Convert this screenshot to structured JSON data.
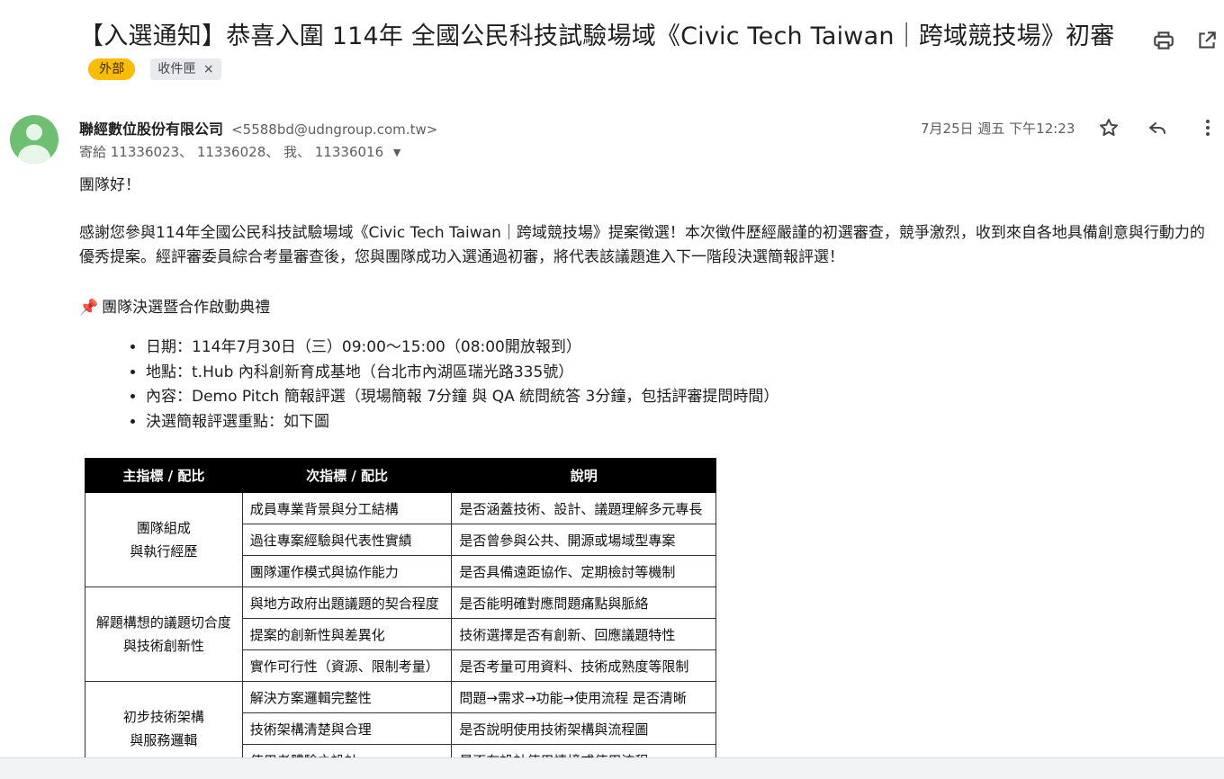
{
  "subject": {
    "title": "【入選通知】恭喜入圍 114年 全國公民科技試驗場域《Civic Tech Taiwan｜跨域競技場》初審",
    "badge_external": "外部",
    "badge_inbox": "收件匣",
    "badge_inbox_close": "×"
  },
  "toolbar": {
    "print_icon": "print-icon",
    "popout_icon": "open-in-new-window-icon"
  },
  "message": {
    "sender_name": "聯經數位股份有限公司",
    "sender_email": "<5588bd@udngroup.com.tw>",
    "recipients": "寄給 11336023、 11336028、 我、 11336016",
    "date": "7月25日 週五 下午12:23",
    "greeting": "團隊好！",
    "paragraph": "感謝您參與114年全國公民科技試驗場域《Civic Tech Taiwan｜跨域競技場》提案徵選！本次徵件歷經嚴謹的初選審查，競爭激烈，收到來自各地具備創意與行動力的優秀提案。經評審委員綜合考量審查後，您與團隊成功入選通過初審，將代表該議題進入下一階段決選簡報評選！",
    "section_icon": "📌",
    "section_title": "團隊決選暨合作啟動典禮",
    "details": [
      "日期：114年7月30日（三）09:00～15:00（08:00開放報到）",
      "地點：t.Hub 內科創新育成基地（台北市內湖區瑞光路335號）",
      "內容：Demo Pitch 簡報評選（現場簡報 7分鐘 與 QA 統問統答 3分鐘，包括評審提問時間）",
      "決選簡報評選重點：如下圖"
    ]
  },
  "table": {
    "headers": [
      "主指標 / 配比",
      "次指標 / 配比",
      "說明"
    ],
    "groups": [
      {
        "main_line1": "團隊組成",
        "main_line2": "與執行經歷",
        "rows": [
          [
            "成員專業背景與分工結構",
            "是否涵蓋技術、設計、議題理解多元專長"
          ],
          [
            "過往專案經驗與代表性實績",
            "是否曾參與公共、開源或場域型專案"
          ],
          [
            "團隊運作模式與協作能力",
            "是否具備遠距協作、定期檢討等機制"
          ]
        ]
      },
      {
        "main_line1": "解題構想的議題切合度",
        "main_line2": "與技術創新性",
        "rows": [
          [
            "與地方政府出題議題的契合程度",
            "是否能明確對應問題痛點與脈絡"
          ],
          [
            "提案的創新性與差異化",
            "技術選擇是否有創新、回應議題特性"
          ],
          [
            "實作可行性（資源、限制考量）",
            "是否考量可用資料、技術成熟度等限制"
          ]
        ]
      },
      {
        "main_line1": "初步技術架構",
        "main_line2": "與服務邏輯",
        "rows": [
          [
            "解決方案邏輯完整性",
            "問題→需求→功能→使用流程 是否清晰"
          ],
          [
            "技術架構清楚與合理",
            "是否說明使用技術架構與流程圖"
          ],
          [
            "使用者體驗之設計",
            "是否有設計使用情境或使用流程"
          ]
        ]
      }
    ]
  }
}
